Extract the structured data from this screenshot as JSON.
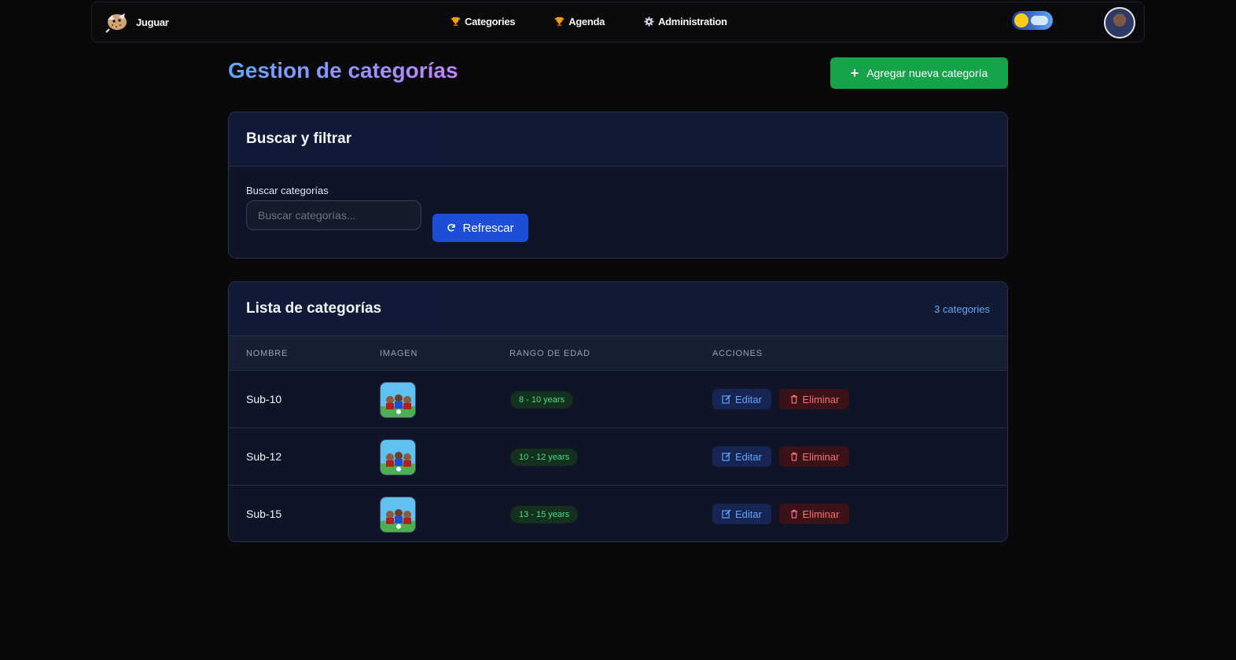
{
  "nav": {
    "brand": "Juguar",
    "links": [
      {
        "label": "Categories",
        "icon": "trophy-icon"
      },
      {
        "label": "Agenda",
        "icon": "trophy-icon"
      },
      {
        "label": "Administration",
        "icon": "gear-icon"
      }
    ]
  },
  "page": {
    "title": "Gestion de categorías",
    "add_button": "Agregar nueva categoría"
  },
  "search": {
    "title": "Buscar y filtrar",
    "label": "Buscar categorías",
    "placeholder": "Buscar categorías...",
    "refresh": "Refrescar"
  },
  "list": {
    "title": "Lista de categorías",
    "count": "3 categories",
    "columns": [
      "NOMBRE",
      "IMAGEN",
      "RANGO DE EDAD",
      "ACCIONES"
    ],
    "rows": [
      {
        "name": "Sub-10",
        "age": "8 - 10 years",
        "edit": "Editar",
        "delete": "Eliminar"
      },
      {
        "name": "Sub-12",
        "age": "10 - 12 years",
        "edit": "Editar",
        "delete": "Eliminar"
      },
      {
        "name": "Sub-15",
        "age": "13 - 15 years",
        "edit": "Editar",
        "delete": "Eliminar"
      }
    ]
  },
  "colors": {
    "accent_green": "#16a34a",
    "accent_blue": "#1d4ed8",
    "title_gradient_start": "#60a5fa",
    "title_gradient_end": "#c084fc"
  }
}
